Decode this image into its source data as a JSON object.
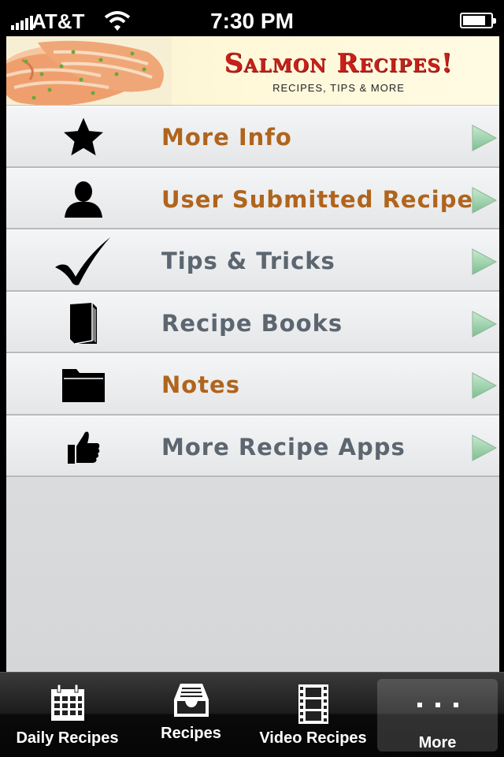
{
  "status_bar": {
    "carrier": "AT&T",
    "time": "7:30 PM"
  },
  "banner": {
    "title": "Salmon Recipes!",
    "subtitle": "RECIPES, TIPS & MORE"
  },
  "menu": {
    "items": [
      {
        "label": "More Info",
        "icon": "star-icon",
        "color": "#b0641c"
      },
      {
        "label": "User Submitted Recipes",
        "icon": "user-icon",
        "color": "#b0641c"
      },
      {
        "label": "Tips & Tricks",
        "icon": "checkmark-icon",
        "color": "#5c6670"
      },
      {
        "label": "Recipe Books",
        "icon": "book-icon",
        "color": "#5c6670"
      },
      {
        "label": "Notes",
        "icon": "folder-icon",
        "color": "#b0641c"
      },
      {
        "label": "More Recipe Apps",
        "icon": "thumbs-up-icon",
        "color": "#5c6670"
      }
    ]
  },
  "tab_bar": {
    "tabs": [
      {
        "label": "Daily Recipes",
        "icon": "calendar-icon",
        "selected": false
      },
      {
        "label": "Recipes",
        "icon": "inbox-tray-icon",
        "selected": false
      },
      {
        "label": "Video Recipes",
        "icon": "film-strip-icon",
        "selected": false
      },
      {
        "label": "More",
        "icon": "more-dots-icon",
        "selected": true
      }
    ]
  },
  "colors": {
    "accent_orange": "#b0641c",
    "muted_gray": "#5c6670",
    "banner_red": "#c8201a",
    "arrow_green": "#8fc9a0"
  }
}
